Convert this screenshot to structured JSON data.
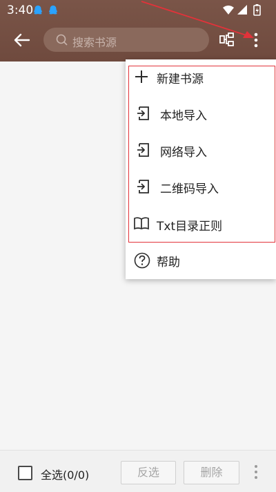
{
  "status_bar": {
    "time": "3:40"
  },
  "toolbar": {
    "search_placeholder": "搜索书源"
  },
  "menu": {
    "items": [
      {
        "label": "新建书源",
        "icon": "plus-icon"
      },
      {
        "label": "本地导入",
        "icon": "import-icon"
      },
      {
        "label": "网络导入",
        "icon": "import-icon"
      },
      {
        "label": "二维码导入",
        "icon": "import-icon"
      },
      {
        "label": "Txt目录正则",
        "icon": "book-icon"
      },
      {
        "label": "帮助",
        "icon": "help-icon"
      }
    ]
  },
  "bottom_bar": {
    "select_all_label": "全选(0/0)",
    "invert_label": "反选",
    "delete_label": "删除"
  },
  "colors": {
    "toolbar": "#74503f",
    "annotation": "#e2323a"
  }
}
